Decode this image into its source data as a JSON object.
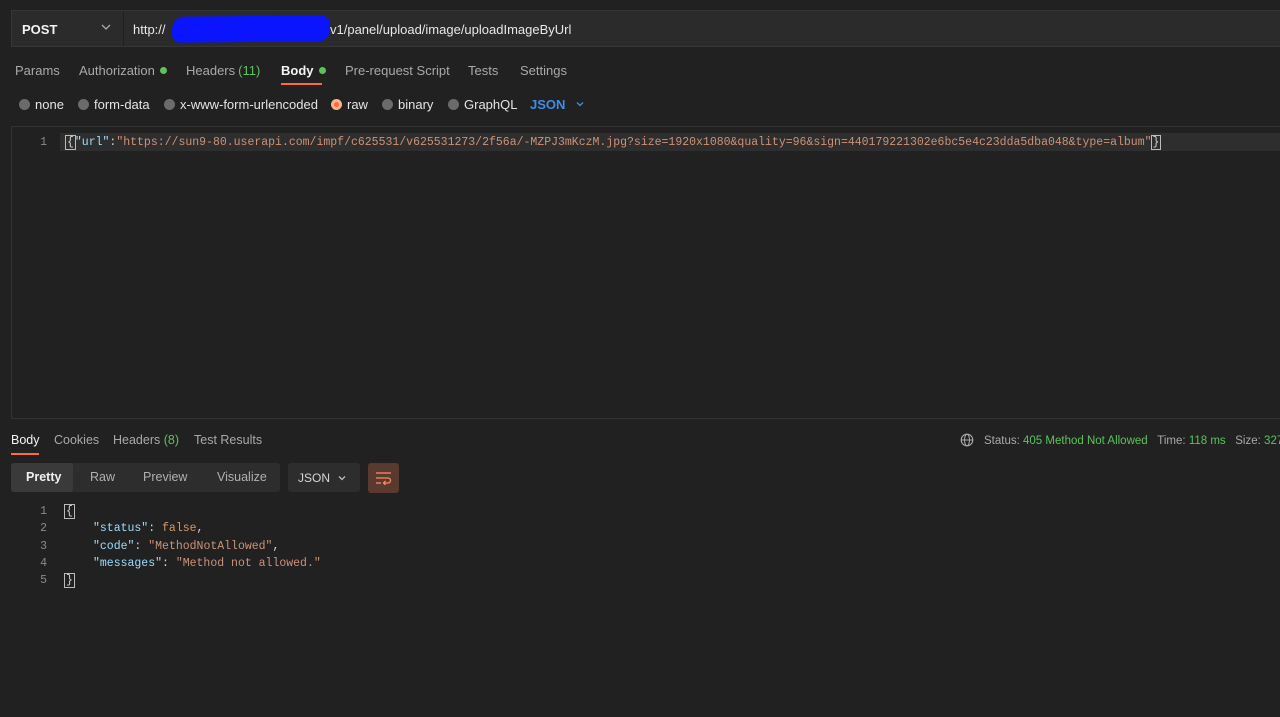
{
  "request": {
    "method": "POST",
    "url_prefix": "http://",
    "url_suffix": "v1/panel/upload/image/uploadImageByUrl"
  },
  "request_tabs": [
    {
      "label": "Params"
    },
    {
      "label": "Authorization"
    },
    {
      "label": "Headers",
      "count": "(11)"
    },
    {
      "label": "Body"
    },
    {
      "label": "Pre-request Script"
    },
    {
      "label": "Tests"
    },
    {
      "label": "Settings"
    }
  ],
  "body_types": {
    "none": "none",
    "form_data": "form-data",
    "urlencoded": "x-www-form-urlencoded",
    "raw": "raw",
    "binary": "binary",
    "graphql": "GraphQL",
    "format": "JSON",
    "selected": "raw"
  },
  "request_body": {
    "line_number": "1",
    "key": "\"url\"",
    "value": "\"https://sun9-80.userapi.com/impf/c625531/v625531273/2f56a/-MZPJ3mKczM.jpg?size=1920x1080&quality=96&sign=440179221302e6bc5e4c23dda5dba048&type=album\""
  },
  "response_tabs": [
    {
      "label": "Body"
    },
    {
      "label": "Cookies"
    },
    {
      "label": "Headers",
      "count": "(8)"
    },
    {
      "label": "Test Results"
    }
  ],
  "response_meta": {
    "status_label": "Status:",
    "status_value": "405 Method Not Allowed",
    "time_label": "Time:",
    "time_value": "118 ms",
    "size_label": "Size:",
    "size_value": "327"
  },
  "view_modes": [
    "Pretty",
    "Raw",
    "Preview",
    "Visualize"
  ],
  "response_format": "JSON",
  "response_body": {
    "line_numbers": [
      "1",
      "2",
      "3",
      "4",
      "5"
    ],
    "open_brace": "{",
    "close_brace": "}",
    "lines": [
      {
        "key": "\"status\"",
        "value": "false",
        "trail": ","
      },
      {
        "key": "\"code\"",
        "value": "\"MethodNotAllowed\"",
        "trail": ","
      },
      {
        "key": "\"messages\"",
        "value": "\"Method not allowed.\"",
        "trail": ""
      }
    ]
  },
  "colors": {
    "accent": "#ff6c37",
    "success": "#5ac35a",
    "link": "#3d8ee8",
    "background": "#212121"
  }
}
